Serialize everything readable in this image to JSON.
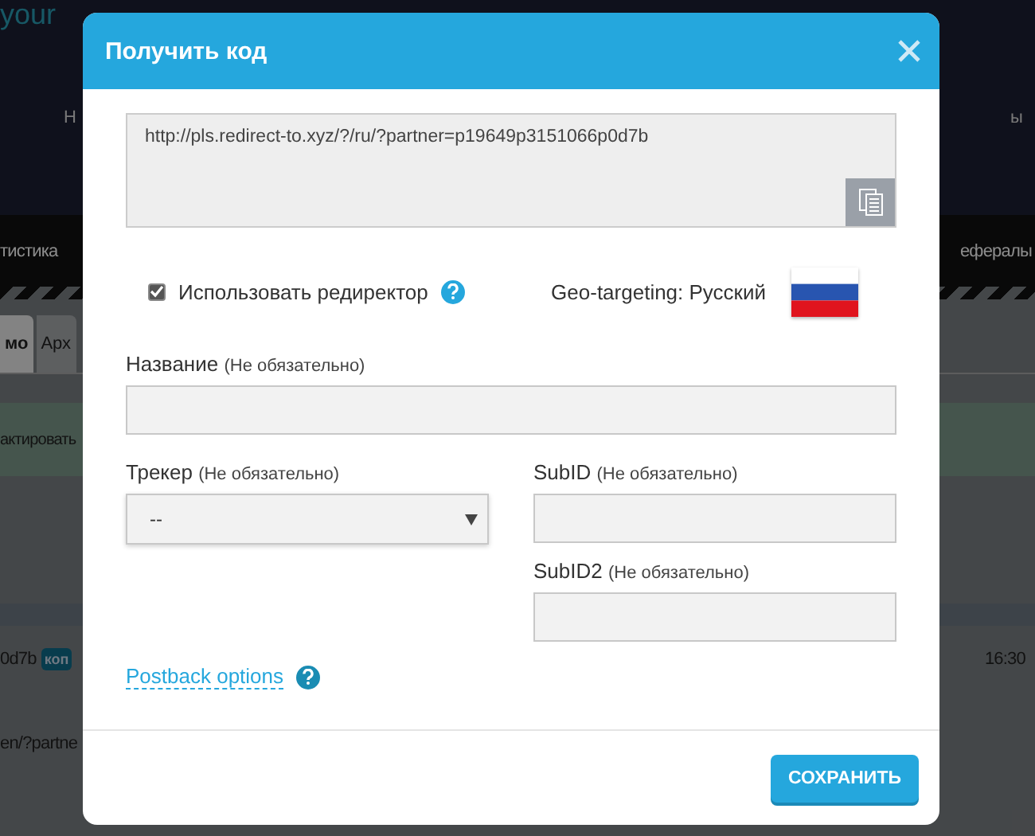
{
  "background": {
    "headline": "your",
    "header_left": "Н",
    "header_right": "ы",
    "nav_left": "тистика",
    "nav_right": "ефералы",
    "tabs": [
      {
        "label": "мо",
        "selected": true
      },
      {
        "label": "Арх",
        "selected": false
      }
    ],
    "notice": "актировать",
    "code": "0d7b",
    "badge": "коп",
    "time": "16:30",
    "link": "en/?partne"
  },
  "dialog": {
    "title": "Получить код",
    "url": "http://pls.redirect-to.xyz/?/ru/?partner=p19649p3151066p0d7b",
    "redirect": {
      "label": "Использовать редиректор",
      "checked": true
    },
    "geo": "Geo-targeting: Русский",
    "name": {
      "label": "Название",
      "hint": "(Не обязательно)"
    },
    "tracker": {
      "label": "Трекер",
      "hint": "(Не обязательно)",
      "value": "--"
    },
    "subid": {
      "label": "SubID",
      "hint": "(Не обязательно)"
    },
    "subid2": {
      "label": "SubID2",
      "hint": "(Не обязательно)"
    },
    "postback": "Postback options",
    "save": "СОХРАНИТЬ"
  }
}
